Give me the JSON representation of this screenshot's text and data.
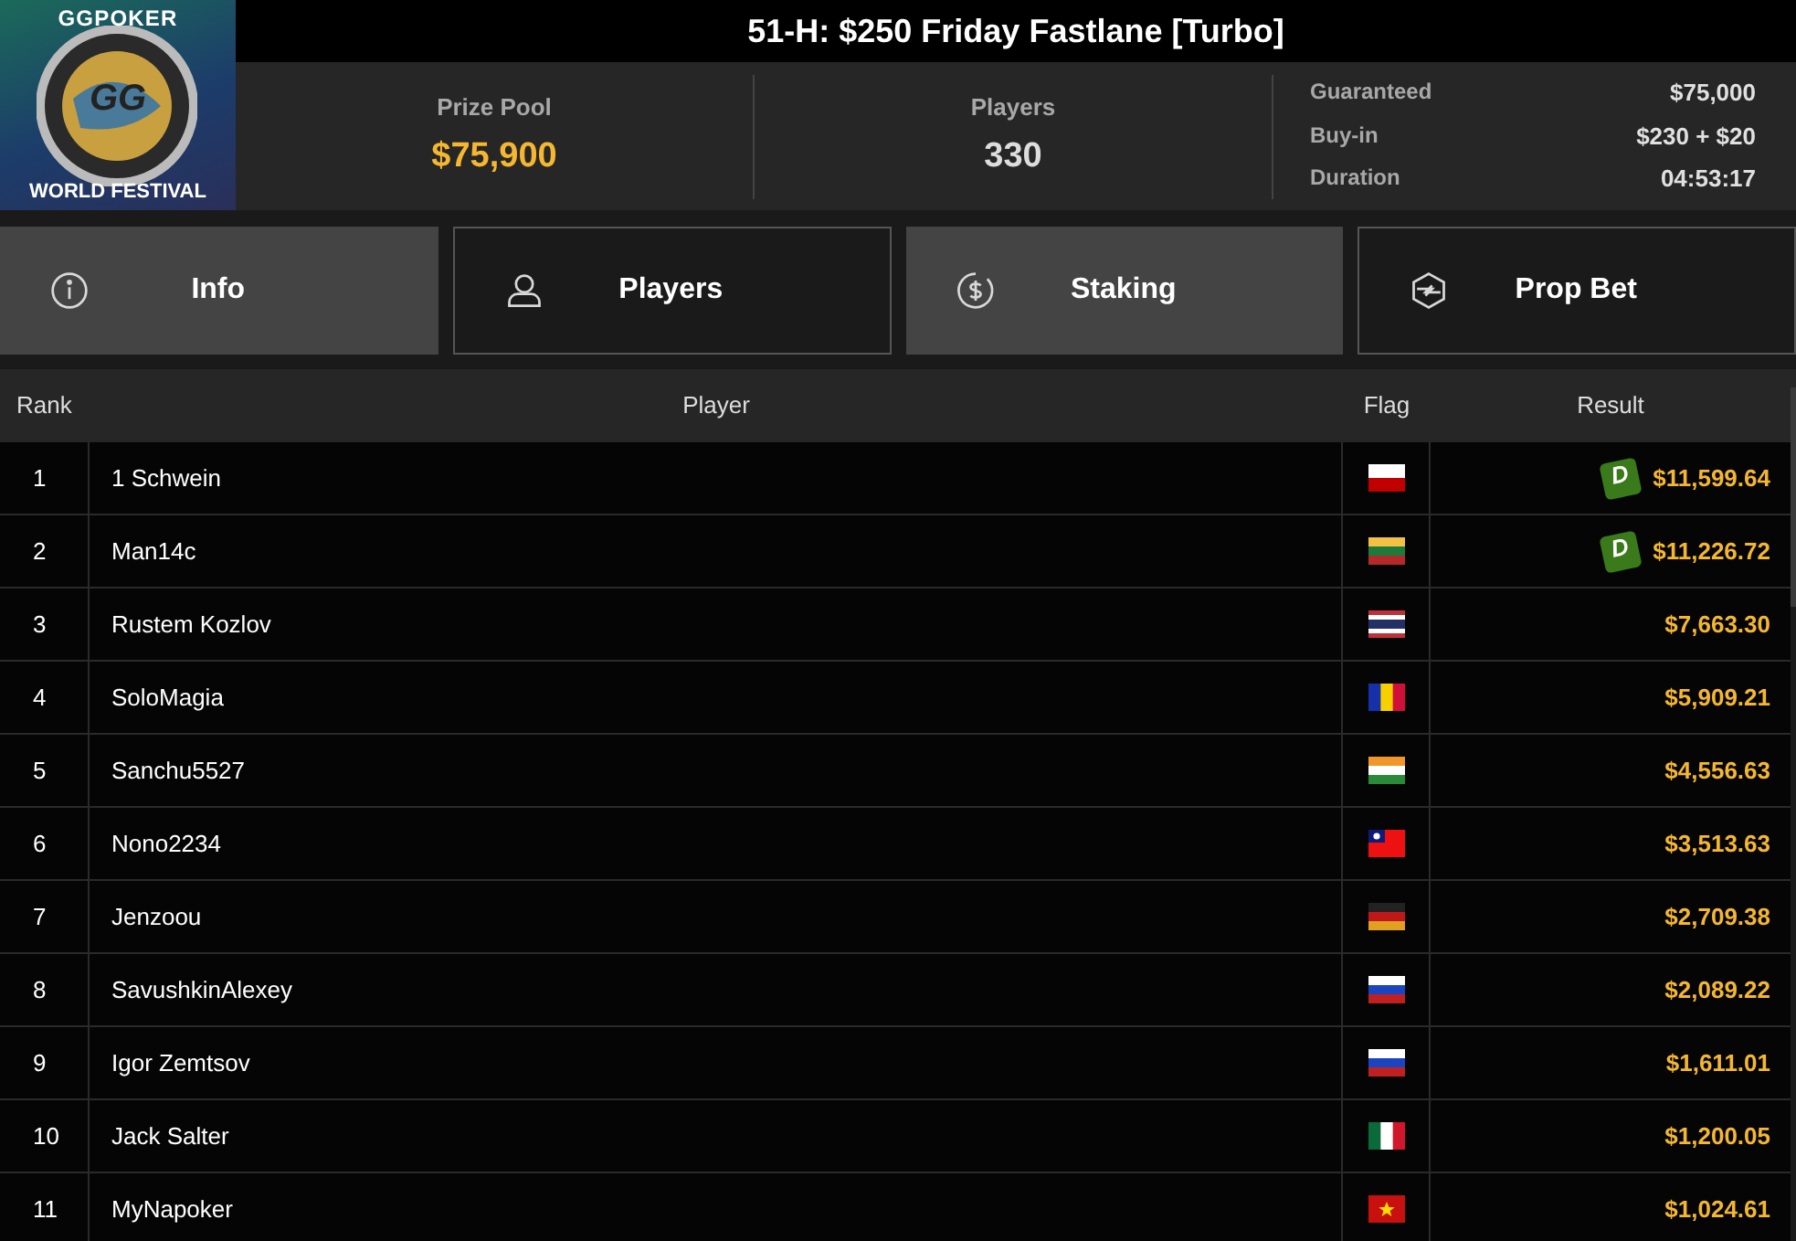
{
  "logo": {
    "top": "GGPOKER",
    "mark": "GG",
    "bottom": "WORLD FESTIVAL"
  },
  "title": "51-H: $250 Friday Fastlane [Turbo]",
  "stats": [
    {
      "label": "Prize Pool",
      "value": "$75,900",
      "highlight": true
    },
    {
      "label": "Players",
      "value": "330",
      "highlight": false
    }
  ],
  "details": [
    {
      "label": "Guaranteed",
      "value": "$75,000"
    },
    {
      "label": "Buy-in",
      "value": "$230 + $20"
    },
    {
      "label": "Duration",
      "value": "04:53:17"
    }
  ],
  "tabs": [
    {
      "label": "Info",
      "kind": "info",
      "selected": true
    },
    {
      "label": "Players",
      "kind": "person",
      "selected": false
    },
    {
      "label": "Staking",
      "kind": "dollar",
      "selected": true
    },
    {
      "label": "Prop Bet",
      "kind": "propbet",
      "selected": false
    }
  ],
  "table": {
    "columns": [
      "Rank",
      "Player",
      "Flag",
      "Result"
    ],
    "rows": [
      {
        "rank": "1",
        "player": "1 Schwein",
        "kind": "poland",
        "deal": true,
        "deal_label": "D",
        "result": "$11,599.64"
      },
      {
        "rank": "2",
        "player": "Man14c",
        "kind": "lithuania",
        "deal": true,
        "deal_label": "D",
        "result": "$11,226.72"
      },
      {
        "rank": "3",
        "player": "Rustem Kozlov",
        "kind": "thailand",
        "deal": false,
        "result": "$7,663.30"
      },
      {
        "rank": "4",
        "player": "SoloMagia",
        "kind": "andorra",
        "deal": false,
        "result": "$5,909.21"
      },
      {
        "rank": "5",
        "player": "Sanchu5527",
        "kind": "india",
        "deal": false,
        "result": "$4,556.63"
      },
      {
        "rank": "6",
        "player": "Nono2234",
        "kind": "taiwan",
        "deal": false,
        "result": "$3,513.63"
      },
      {
        "rank": "7",
        "player": "Jenzoou",
        "kind": "germany",
        "deal": false,
        "result": "$2,709.38"
      },
      {
        "rank": "8",
        "player": "SavushkinAlexey",
        "kind": "russia",
        "deal": false,
        "result": "$2,089.22"
      },
      {
        "rank": "9",
        "player": "Igor Zemtsov",
        "kind": "russia",
        "deal": false,
        "result": "$1,611.01"
      },
      {
        "rank": "10",
        "player": "Jack Salter",
        "kind": "mexico",
        "deal": false,
        "result": "$1,200.05"
      },
      {
        "rank": "11",
        "player": "MyNapoker",
        "kind": "vietnam",
        "deal": false,
        "result": "$1,024.61"
      }
    ]
  }
}
